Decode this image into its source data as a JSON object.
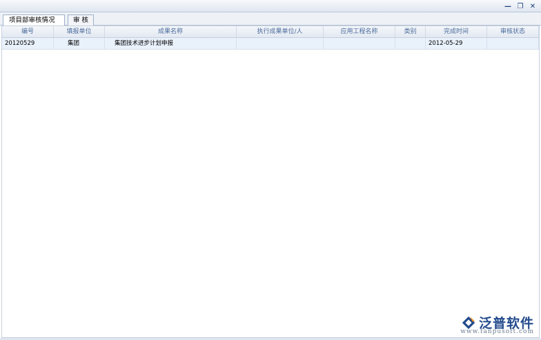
{
  "window": {
    "controls": [
      "minimize-icon",
      "restore-icon",
      "close-icon"
    ],
    "minimize_glyph": "—",
    "restore_glyph": "❐",
    "close_glyph": "✕"
  },
  "tabs": [
    {
      "label": "项目部审核情况",
      "active": true
    },
    {
      "label": "审 核",
      "active": false
    }
  ],
  "table": {
    "columns": [
      "编号",
      "填报单位",
      "成果名称",
      "执行成果单位/人",
      "应用工程名称",
      "类别",
      "完成时间",
      "审核状态"
    ],
    "rows": [
      {
        "id": "20120529",
        "unit": "集团",
        "name": "集团技术进步计划申报",
        "executor": "",
        "project": "",
        "category": "",
        "date": "2012-05-29",
        "status": ""
      }
    ]
  },
  "logo": {
    "text": "泛普软件",
    "url": "www.fanpusoft.com"
  },
  "colors": {
    "header_text": "#4a6a9a",
    "row_bg": "#e9f1fb",
    "logo_blue": "#224a8c",
    "logo_orange": "#f08a1c"
  }
}
